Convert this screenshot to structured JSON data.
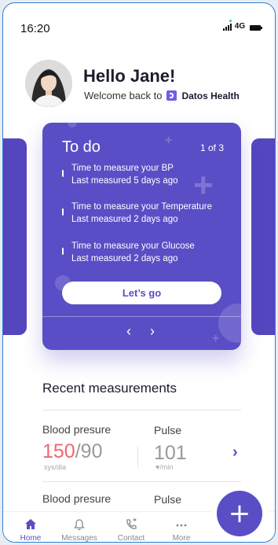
{
  "status_bar": {
    "time": "16:20",
    "network": "4G"
  },
  "header": {
    "greeting": "Hello Jane!",
    "welcome_text": "Welcome back to",
    "brand_name": "Datos Health"
  },
  "todo_card": {
    "title": "To do",
    "page_indicator": "1 of 3",
    "tasks": [
      {
        "title": "Time to measure your BP",
        "subtitle": "Last measured 5 days ago"
      },
      {
        "title": "Time to measure your Temperature",
        "subtitle": "Last measured 2 days ago"
      },
      {
        "title": "Time to measure your Glucose",
        "subtitle": "Last measured 2 days ago"
      }
    ],
    "button_label": "Let’s go",
    "prev_label": "‹",
    "next_label": "›"
  },
  "recent": {
    "title": "Recent measurements",
    "rows": [
      {
        "bp_label": "Blood presure",
        "bp_systolic": "150",
        "bp_separator": "/",
        "bp_diastolic": "90",
        "bp_unit": "sys/dia",
        "pulse_label": "Pulse",
        "pulse_value": "101",
        "pulse_unit": "/min"
      },
      {
        "bp_label": "Blood presure",
        "pulse_label": "Pulse"
      }
    ]
  },
  "nav": {
    "items": [
      {
        "label": "Home",
        "icon": "home-icon"
      },
      {
        "label": "Messages",
        "icon": "bell-icon"
      },
      {
        "label": "Contact",
        "icon": "phone-icon"
      },
      {
        "label": "More",
        "icon": "more-icon"
      }
    ],
    "fab_label": "+"
  },
  "colors": {
    "accent": "#5a4ec6",
    "alert": "#f0676e",
    "frame": "#2f7fd6"
  }
}
